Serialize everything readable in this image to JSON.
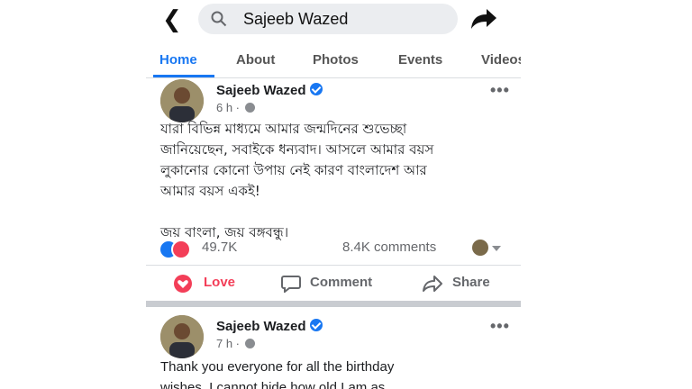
{
  "search": {
    "query": "Sajeeb Wazed"
  },
  "tabs": [
    {
      "label": "Home",
      "active": true
    },
    {
      "label": "About"
    },
    {
      "label": "Photos"
    },
    {
      "label": "Events"
    },
    {
      "label": "Videos"
    }
  ],
  "posts": [
    {
      "author": "Sajeeb Wazed",
      "time": "6 h ·",
      "text_lines": [
        "যারা বিভিন্ন মাধ্যমে আমার জন্মদিনের শুভেচ্ছা",
        "জানিয়েছেন, সবাইকে ধন্যবাদ। আসলে আমার বয়স",
        "লুকানোর কোনো উপায় নেই কারণ বাংলাদেশ আর",
        "আমার বয়স একই!",
        "",
        "জয় বাংলা, জয় বঙ্গবন্ধু।"
      ],
      "reactions_count": "49.7K",
      "comments_count": "8.4K comments",
      "actions": {
        "love": "Love",
        "comment": "Comment",
        "share": "Share"
      }
    },
    {
      "author": "Sajeeb Wazed",
      "time": "7 h ·",
      "text_lines": [
        "Thank you everyone for all the birthday",
        "wishes. I cannot hide how old I am as"
      ]
    }
  ],
  "colors": {
    "accent": "#1877f2",
    "love": "#f33e58",
    "muted": "#65676b"
  }
}
